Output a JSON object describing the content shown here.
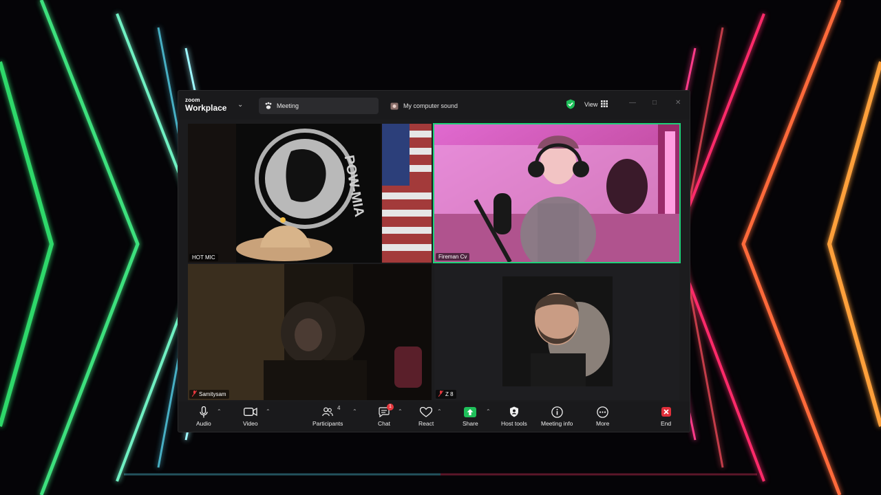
{
  "app": {
    "brand_small": "zoom",
    "brand_big": "Workplace",
    "tab_meeting": "Meeting",
    "tab_sound": "My computer sound",
    "view_label": "View"
  },
  "participants_tiles": [
    {
      "name": "HOT MIC",
      "muted": false
    },
    {
      "name": "Fireman Cv",
      "muted": false,
      "active_speaker": true
    },
    {
      "name": "Samitysam",
      "muted": true
    },
    {
      "name": "Z 8",
      "muted": true
    }
  ],
  "toolbar": {
    "audio": "Audio",
    "video": "Video",
    "participants": "Participants",
    "participants_count": "4",
    "chat": "Chat",
    "chat_badge": "1",
    "react": "React",
    "share": "Share",
    "host_tools": "Host tools",
    "meeting_info": "Meeting info",
    "more": "More",
    "end": "End"
  },
  "colors": {
    "active_speaker_border": "#1fd17a",
    "share_green": "#1fbf5a",
    "end_red": "#e02f3a",
    "window_bg": "#1c1c1e"
  },
  "icons": [
    "zoom-chevron-down-icon",
    "meeting-paw-icon",
    "computer-sound-icon",
    "shield-check-icon",
    "grid-view-icon",
    "minimize-icon",
    "maximize-icon",
    "close-icon",
    "microphone-icon",
    "camera-icon",
    "participants-icon",
    "chat-icon",
    "heart-react-icon",
    "share-arrow-icon",
    "host-shield-icon",
    "info-icon",
    "more-dots-icon",
    "end-x-icon"
  ]
}
